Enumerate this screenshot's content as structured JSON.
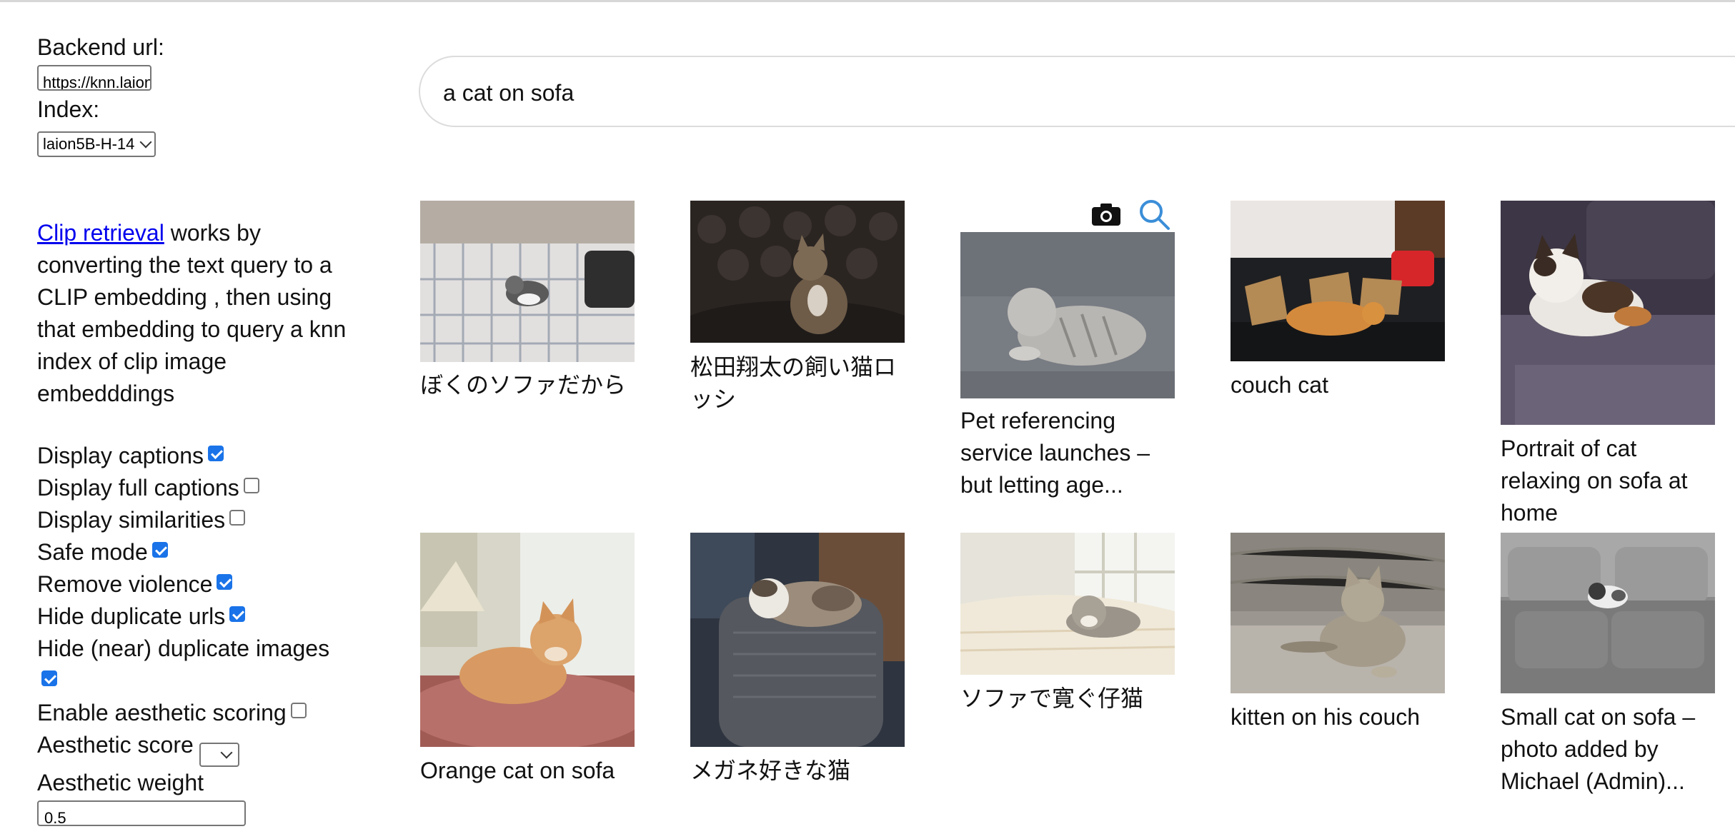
{
  "sidebar": {
    "backend_label": "Backend url:",
    "backend_value": "https://knn.laion.ai",
    "index_label": "Index:",
    "index_value": "laion5B-H-14",
    "description_link": "Clip retrieval",
    "description_rest": " works by converting the text query to a CLIP embedding , then using that embedding to query a knn index of clip image embedddings",
    "options": [
      {
        "label": "Display captions",
        "checked": true
      },
      {
        "label": "Display full captions",
        "checked": false
      },
      {
        "label": "Display similarities",
        "checked": false
      },
      {
        "label": "Safe mode",
        "checked": true
      },
      {
        "label": "Remove violence",
        "checked": true
      },
      {
        "label": "Hide duplicate urls",
        "checked": true
      },
      {
        "label": "Hide (near) duplicate images",
        "checked": true
      },
      {
        "label": "Enable aesthetic scoring",
        "checked": false
      }
    ],
    "aesthetic_score_label": "Aesthetic score",
    "aesthetic_weight_label": "Aesthetic weight",
    "aesthetic_weight_value": "0.5"
  },
  "search": {
    "query": "a cat on sofa"
  },
  "results": [
    {
      "caption": "ぼくのソファだから"
    },
    {
      "caption": "松田翔太の飼い猫ロッシ"
    },
    {
      "caption": "Pet referencing service launches – but letting age..."
    },
    {
      "caption": "couch cat"
    },
    {
      "caption": "Portrait of cat relaxing on sofa at home"
    },
    {
      "caption": "Orange cat on sofa"
    },
    {
      "caption": "メガネ好きな猫"
    },
    {
      "caption": "ソファで寛ぐ仔猫"
    },
    {
      "caption": "kitten on his couch"
    },
    {
      "caption": "Small cat on sofa – photo added by Michael (Admin)..."
    }
  ],
  "icons": {
    "camera": "camera-icon",
    "search": "search-icon"
  },
  "colors": {
    "link": "#0000ee",
    "checkbox": "#1a73e8",
    "search_icon": "#3b8ed8"
  }
}
